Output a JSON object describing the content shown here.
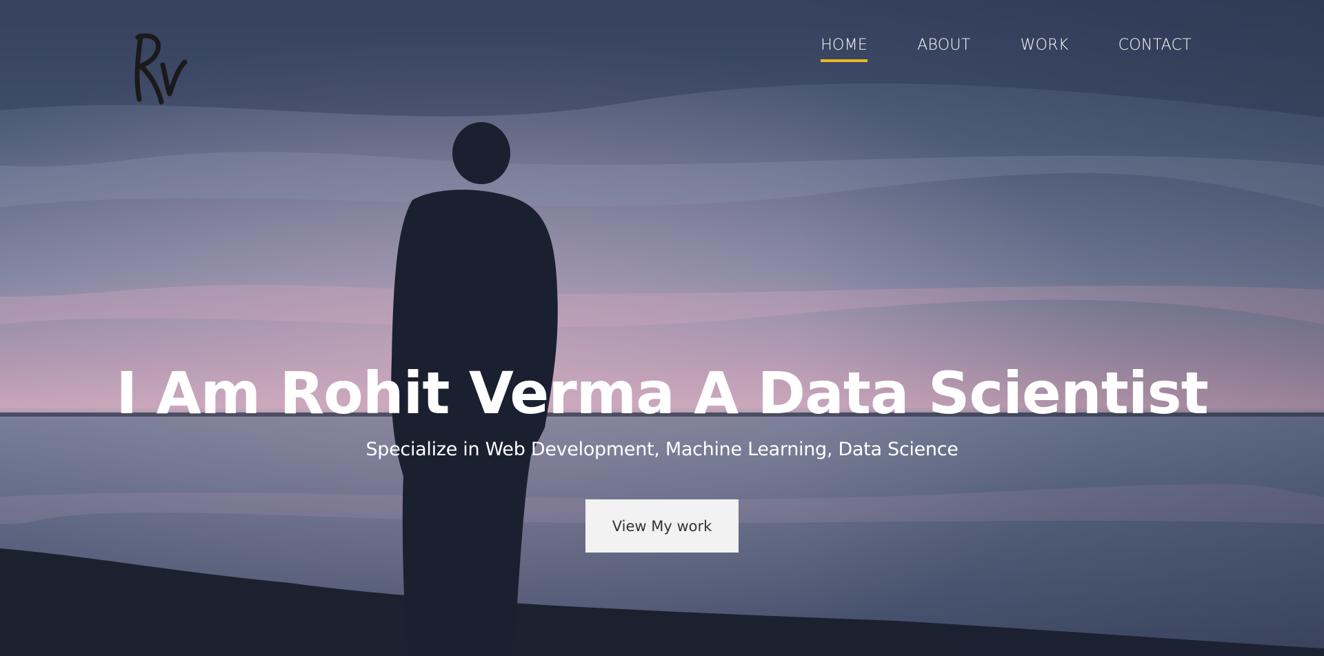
{
  "brand": {
    "logo_icon": "rv-signature-logo"
  },
  "nav": {
    "items": [
      {
        "label": "HOME",
        "active": true
      },
      {
        "label": "ABOUT",
        "active": false
      },
      {
        "label": "WORK",
        "active": false
      },
      {
        "label": "CONTACT",
        "active": false
      }
    ]
  },
  "hero": {
    "title": "I Am Rohit Verma A Data Scientist",
    "subtitle": "Specialize in Web Development, Machine Learning, Data Science",
    "cta_label": "View My work"
  },
  "colors": {
    "accent": "#f2b824",
    "text": "#ffffff",
    "button_bg": "#f2f2f2",
    "button_text": "#333333"
  }
}
